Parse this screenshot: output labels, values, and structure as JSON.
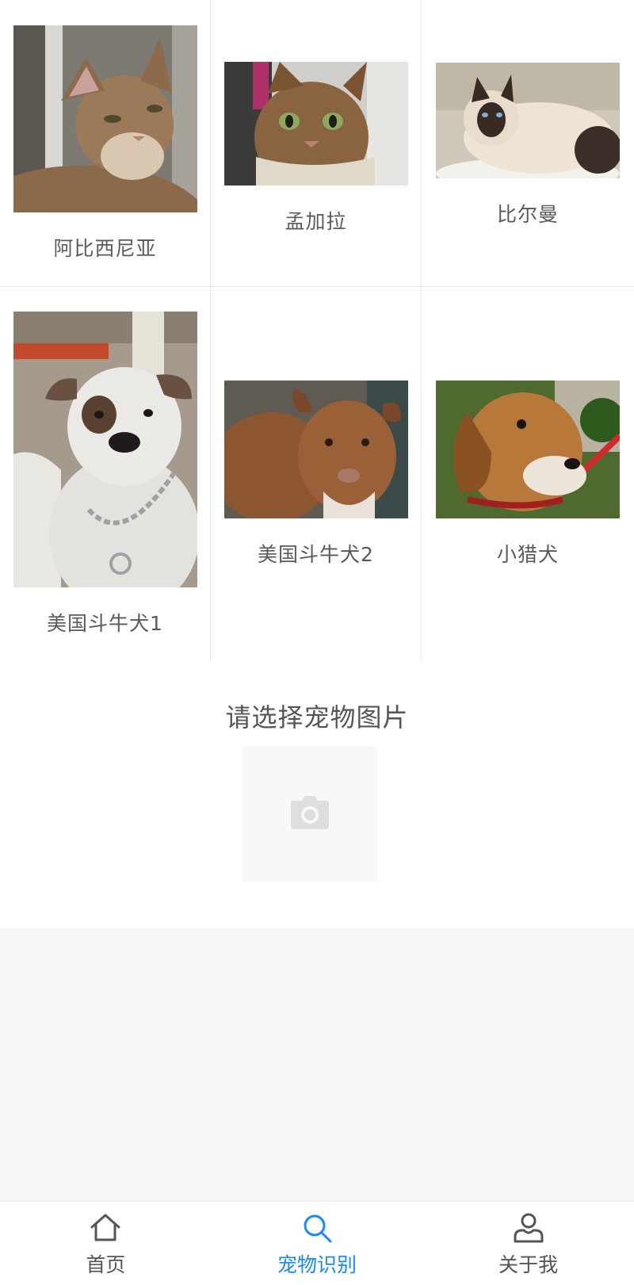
{
  "pets": [
    {
      "name": "阿比西尼亚",
      "icon": "abyssinian-cat-photo"
    },
    {
      "name": "孟加拉",
      "icon": "bengal-cat-photo"
    },
    {
      "name": "比尔曼",
      "icon": "birman-cat-photo"
    },
    {
      "name": "美国斗牛犬1",
      "icon": "american-bulldog-photo"
    },
    {
      "name": "美国斗牛犬2",
      "icon": "american-pit-bull-photo"
    },
    {
      "name": "小猎犬",
      "icon": "beagle-photo"
    }
  ],
  "upload": {
    "title": "请选择宠物图片",
    "icon": "camera-icon"
  },
  "tabbar": {
    "items": [
      {
        "label": "首页",
        "icon": "home-icon"
      },
      {
        "label": "宠物识别",
        "icon": "search-icon"
      },
      {
        "label": "关于我",
        "icon": "user-icon"
      }
    ],
    "active_index": 1
  },
  "colors": {
    "accent": "#1989fa",
    "background": "#f6f6f6",
    "text": "#555555"
  }
}
